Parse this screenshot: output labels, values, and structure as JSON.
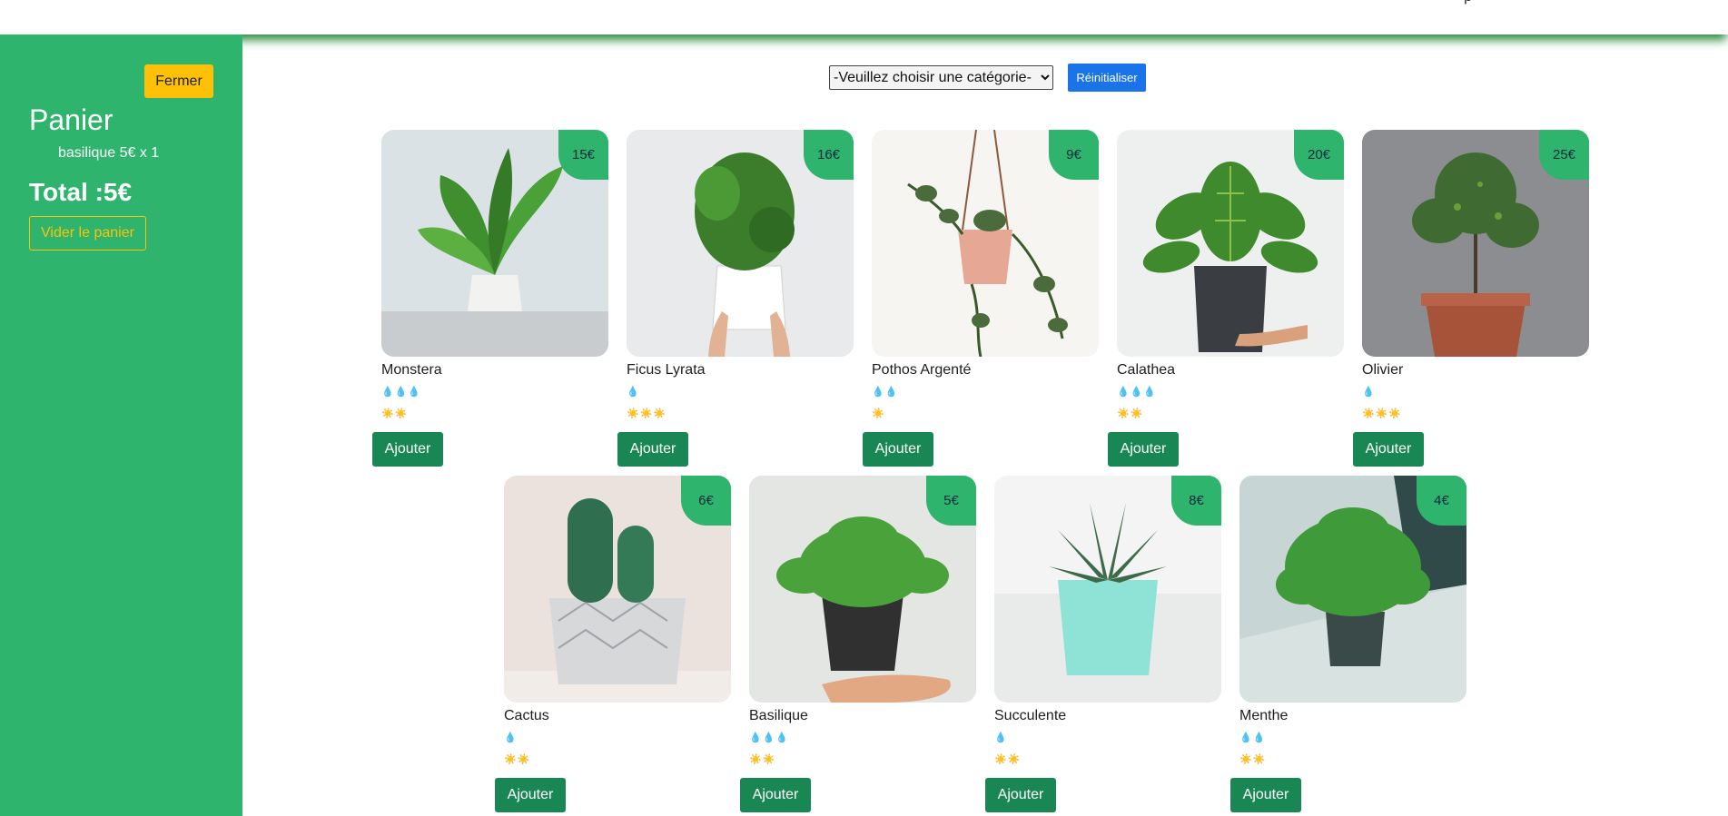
{
  "topbar": {
    "fragment": "p"
  },
  "sidebar": {
    "close_label": "Fermer",
    "title": "Panier",
    "items": [
      {
        "text": "basilique 5€ x 1"
      }
    ],
    "total": "Total :5€",
    "empty_label": "Vider le panier"
  },
  "filter": {
    "selected": "-Veuillez choisir une catégorie-",
    "reset_label": "Réinitialiser"
  },
  "products": [
    {
      "name": "Monstera",
      "price": "15€",
      "water": 3,
      "light": 2
    },
    {
      "name": "Ficus Lyrata",
      "price": "16€",
      "water": 1,
      "light": 3
    },
    {
      "name": "Pothos Argenté",
      "price": "9€",
      "water": 2,
      "light": 1
    },
    {
      "name": "Calathea",
      "price": "20€",
      "water": 3,
      "light": 2
    },
    {
      "name": "Olivier",
      "price": "25€",
      "water": 1,
      "light": 3
    },
    {
      "name": "Cactus",
      "price": "6€",
      "water": 1,
      "light": 2
    },
    {
      "name": "Basilique",
      "price": "5€",
      "water": 3,
      "light": 2
    },
    {
      "name": "Succulente",
      "price": "8€",
      "water": 1,
      "light": 2
    },
    {
      "name": "Menthe",
      "price": "4€",
      "water": 2,
      "light": 2
    }
  ],
  "add_label": "Ajouter",
  "colors": {
    "sidebar": "#2eb46c",
    "accent_yellow": "#ffc107",
    "button_green": "#198754",
    "reset_blue": "#1a73e8"
  }
}
